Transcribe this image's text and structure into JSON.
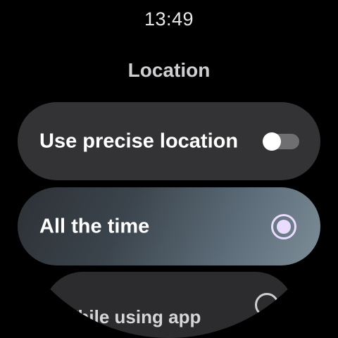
{
  "status_bar": {
    "time": "13:49"
  },
  "screen": {
    "title": "Location"
  },
  "options": {
    "precise": {
      "label": "Use precise location",
      "toggle_on": false
    },
    "all_the_time": {
      "label": "All the time",
      "selected": true
    },
    "while_using": {
      "label": "While using app",
      "selected": false
    }
  },
  "colors": {
    "background": "#000000",
    "chip": "#333335",
    "selected_chip_gradient_end": "#7c8d98",
    "radio_accent": "#eadcff",
    "toggle_track_off": "#6f6f72"
  },
  "icons": {
    "toggle": "toggle-switch-off",
    "radio_selected": "radio-button-checked-icon",
    "radio_unselected": "radio-button-unchecked-icon"
  }
}
